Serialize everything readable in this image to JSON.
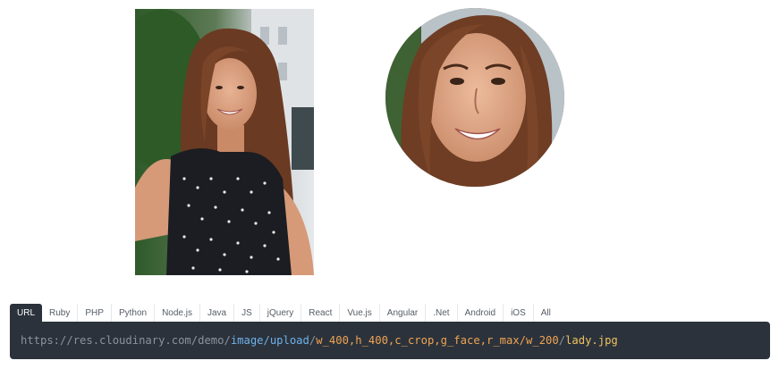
{
  "colors": {
    "background": "#ffffff",
    "code_bg": "#2b323c",
    "tab_active_bg": "#2b323c",
    "tab_active_text": "#ffffff",
    "tab_text": "#555d66",
    "url_base": "#8a939d",
    "url_path": "#6fb2e8",
    "url_transform": "#f0a451",
    "url_file": "#f0c45e"
  },
  "images": {
    "original": {
      "icon": "portrait-photo"
    },
    "transformed": {
      "icon": "circle-face-crop-photo"
    }
  },
  "tabs": [
    {
      "label": "URL",
      "active": true
    },
    {
      "label": "Ruby",
      "active": false
    },
    {
      "label": "PHP",
      "active": false
    },
    {
      "label": "Python",
      "active": false
    },
    {
      "label": "Node.js",
      "active": false
    },
    {
      "label": "Java",
      "active": false
    },
    {
      "label": "JS",
      "active": false
    },
    {
      "label": "jQuery",
      "active": false
    },
    {
      "label": "React",
      "active": false
    },
    {
      "label": "Vue.js",
      "active": false
    },
    {
      "label": "Angular",
      "active": false
    },
    {
      "label": ".Net",
      "active": false
    },
    {
      "label": "Android",
      "active": false
    },
    {
      "label": "iOS",
      "active": false
    },
    {
      "label": "All",
      "active": false
    }
  ],
  "code": {
    "base": "https://res.cloudinary.com/demo/",
    "path": "image/upload",
    "sep1": "/",
    "transform": "w_400,h_400,c_crop,g_face,r_max/w_200",
    "sep2": "/",
    "file": "lady.jpg"
  }
}
